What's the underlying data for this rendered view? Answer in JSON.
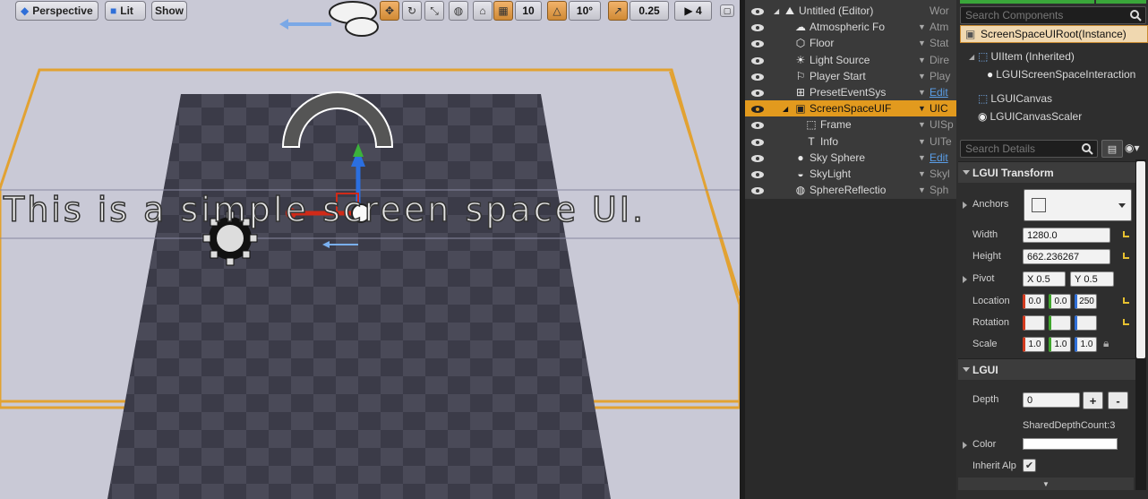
{
  "viewport": {
    "perspective_label": "Perspective",
    "lit_label": "Lit",
    "show_label": "Show",
    "grid_snap_value": "10",
    "rotation_snap_value": "10°",
    "scale_snap_value": "0.25",
    "camera_speed_value": "4",
    "overlay_text": "This is a simple screen space UI."
  },
  "outliner": {
    "rows": [
      {
        "label": "Untitled (Editor)",
        "type": "Wor",
        "icon": "level-icon",
        "link": false,
        "selected": false
      },
      {
        "label": "Atmospheric Fo",
        "type": "Atm",
        "icon": "fog-icon",
        "link": false,
        "selected": false
      },
      {
        "label": "Floor",
        "type": "Stat",
        "icon": "static-mesh-icon",
        "link": false,
        "selected": false
      },
      {
        "label": "Light Source",
        "type": "Dire",
        "icon": "light-icon",
        "link": false,
        "selected": false
      },
      {
        "label": "Player Start",
        "type": "Play",
        "icon": "player-start-icon",
        "link": false,
        "selected": false
      },
      {
        "label": "PresetEventSys",
        "type": "Edit",
        "icon": "event-system-icon",
        "link": true,
        "selected": false
      },
      {
        "label": "ScreenSpaceUIF",
        "type": "UIC",
        "icon": "screen-space-ui-icon",
        "link": false,
        "selected": true
      },
      {
        "label": "Frame",
        "type": "UISp",
        "icon": "frame-icon",
        "link": false,
        "selected": false
      },
      {
        "label": "Info",
        "type": "UITe",
        "icon": "text-icon",
        "link": false,
        "selected": false
      },
      {
        "label": "Sky Sphere",
        "type": "Edit",
        "icon": "sphere-icon",
        "link": true,
        "selected": false
      },
      {
        "label": "SkyLight",
        "type": "Skyl",
        "icon": "skylight-icon",
        "link": false,
        "selected": false
      },
      {
        "label": "SphereReflectio",
        "type": "Sph",
        "icon": "reflection-icon",
        "link": false,
        "selected": false
      }
    ]
  },
  "details": {
    "search_components_placeholder": "Search Components",
    "root_component": "ScreenSpaceUIRoot(Instance)",
    "components": [
      "UIItem (Inherited)",
      "LGUIScreenSpaceInteraction",
      "LGUICanvas",
      "LGUICanvasScaler"
    ],
    "search_details_placeholder": "Search Details",
    "section_transform": "LGUI Transform",
    "anchors_label": "Anchors",
    "width_label": "Width",
    "width_value": "1280.0",
    "height_label": "Height",
    "height_value": "662.236267",
    "pivot_label": "Pivot",
    "pivot_x_label": "X",
    "pivot_x_value": "0.5",
    "pivot_y_label": "Y",
    "pivot_y_value": "0.5",
    "location_label": "Location",
    "location": [
      "0.0",
      "0.0",
      "250"
    ],
    "rotation_label": "Rotation",
    "scale_label": "Scale",
    "scale": [
      "1.0",
      "1.0",
      "1.0"
    ],
    "section_lgui": "LGUI",
    "depth_label": "Depth",
    "depth_value": "0",
    "plus_label": "+",
    "minus_label": "-",
    "shared_depth_text": "SharedDepthCount:3",
    "color_label": "Color",
    "color_value": "#ffffff",
    "inherit_alpha_label": "Inherit Alp"
  }
}
